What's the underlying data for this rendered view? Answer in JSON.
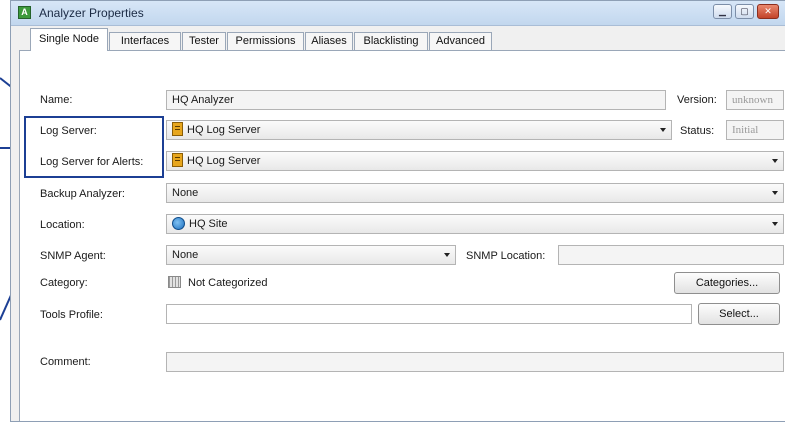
{
  "window": {
    "title": "Analyzer Properties",
    "icon": "analyzer-app-icon"
  },
  "tabs": [
    "Single Node",
    "Interfaces",
    "Tester",
    "Permissions",
    "Aliases",
    "Blacklisting",
    "Advanced"
  ],
  "active_tab": "Single Node",
  "form": {
    "name_label": "Name:",
    "name_value": "HQ Analyzer",
    "version_label": "Version:",
    "version_value": "unknown",
    "log_server_label": "Log Server:",
    "log_server_value": "HQ Log Server",
    "status_label": "Status:",
    "status_value": "Initial",
    "log_server_alerts_label": "Log Server for Alerts:",
    "log_server_alerts_value": "HQ Log Server",
    "backup_label": "Backup Analyzer:",
    "backup_value": "None",
    "location_label": "Location:",
    "location_value": "HQ Site",
    "snmp_agent_label": "SNMP Agent:",
    "snmp_agent_value": "None",
    "snmp_location_label": "SNMP Location:",
    "snmp_location_value": "",
    "category_label": "Category:",
    "category_value": "Not Categorized",
    "categories_button": "Categories...",
    "tools_profile_label": "Tools Profile:",
    "tools_profile_value": "",
    "select_button": "Select...",
    "comment_label": "Comment:",
    "comment_value": ""
  },
  "colors": {
    "callout": "#1c3f94",
    "titlebar": "#c9dcf2",
    "close": "#c9482f"
  }
}
